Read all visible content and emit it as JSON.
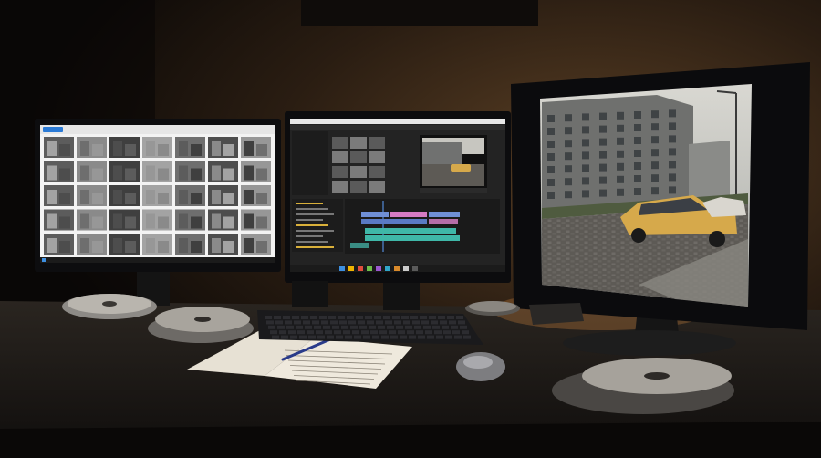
{
  "scene": {
    "description_free": true,
    "monitors": [
      {
        "name": "left-monitor",
        "content": "photo-grid-browser",
        "tiles": 35
      },
      {
        "name": "center-monitor",
        "content": "video-editor-timeline"
      },
      {
        "name": "right-monitor",
        "content": "photo-viewer"
      }
    ],
    "objects": [
      "film-reel",
      "film-reel",
      "film-reel",
      "film-reel",
      "film-reel",
      "keyboard",
      "notebook",
      "pen",
      "mouse",
      "external-drive",
      "desk-lamp-glow"
    ]
  },
  "colors": {
    "wall_top": "#1c140d",
    "wall_warm": "#4a3420",
    "desk": "#1f1b17",
    "bezel": "#0d0d0f",
    "screen_white": "#f3f3f3",
    "editor_bg": "#232323",
    "taskbar": "#1b1b1b",
    "car_yellow": "#d6a94b",
    "sky": "#c9c8c2",
    "building": "#6b6c6a",
    "cobble": "#5f5c57",
    "timeline_teal": "#3fb7a8",
    "timeline_pink": "#d57bc3",
    "timeline_blue": "#6f8fd6"
  }
}
